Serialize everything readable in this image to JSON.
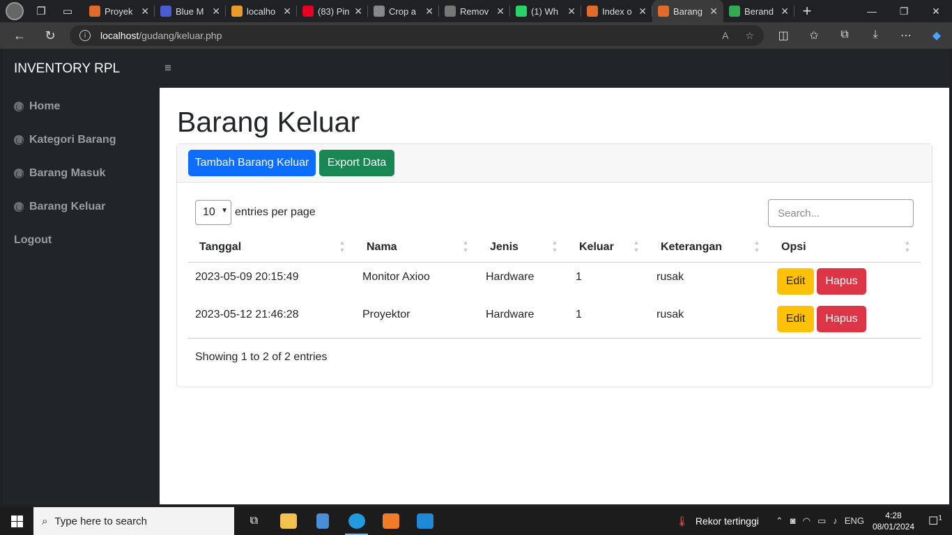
{
  "browser": {
    "tabs": [
      {
        "title": "Proyek",
        "color": "#e06b2a"
      },
      {
        "title": "Blue M",
        "color": "#4a5bd6"
      },
      {
        "title": "localho",
        "color": "#e89b2a"
      },
      {
        "title": "(83) Pin",
        "color": "#e60023"
      },
      {
        "title": "Crop a",
        "color": "#888888"
      },
      {
        "title": "Remov",
        "color": "#777777"
      },
      {
        "title": "(1) Wh",
        "color": "#25d366"
      },
      {
        "title": "Index o",
        "color": "#e06b2a"
      },
      {
        "title": "Barang",
        "color": "#e06b2a"
      },
      {
        "title": "Berand",
        "color": "#34a853"
      }
    ],
    "active_tab_index": 8,
    "url_host": "localhost",
    "url_path": "/gudang/keluar.php"
  },
  "app": {
    "brand": "INVENTORY RPL",
    "toggle_icon": "≡"
  },
  "sidebar": {
    "items": [
      {
        "label": "Home"
      },
      {
        "label": "Kategori Barang"
      },
      {
        "label": "Barang Masuk"
      },
      {
        "label": "Barang Keluar"
      },
      {
        "label": "Logout"
      }
    ]
  },
  "main": {
    "title": "Barang Keluar",
    "add_button": "Tambah Barang Keluar",
    "export_button": "Export Data",
    "entries_value": "10",
    "entries_label": "entries per page",
    "search_placeholder": "Search...",
    "columns": [
      "Tanggal",
      "Nama",
      "Jenis",
      "Keluar",
      "Keterangan",
      "Opsi"
    ],
    "rows": [
      {
        "tanggal": "2023-05-09 20:15:49",
        "nama": "Monitor Axioo",
        "jenis": "Hardware",
        "keluar": "1",
        "keterangan": "rusak"
      },
      {
        "tanggal": "2023-05-12 21:46:28",
        "nama": "Proyektor",
        "jenis": "Hardware",
        "keluar": "1",
        "keterangan": "rusak"
      }
    ],
    "edit_label": "Edit",
    "delete_label": "Hapus",
    "showing": "Showing 1 to 2 of 2 entries"
  },
  "taskbar": {
    "search_placeholder": "Type here to search",
    "weather": "Rekor tertinggi",
    "lang": "ENG",
    "time": "4:28",
    "date": "08/01/2024",
    "notification_count": "1"
  }
}
